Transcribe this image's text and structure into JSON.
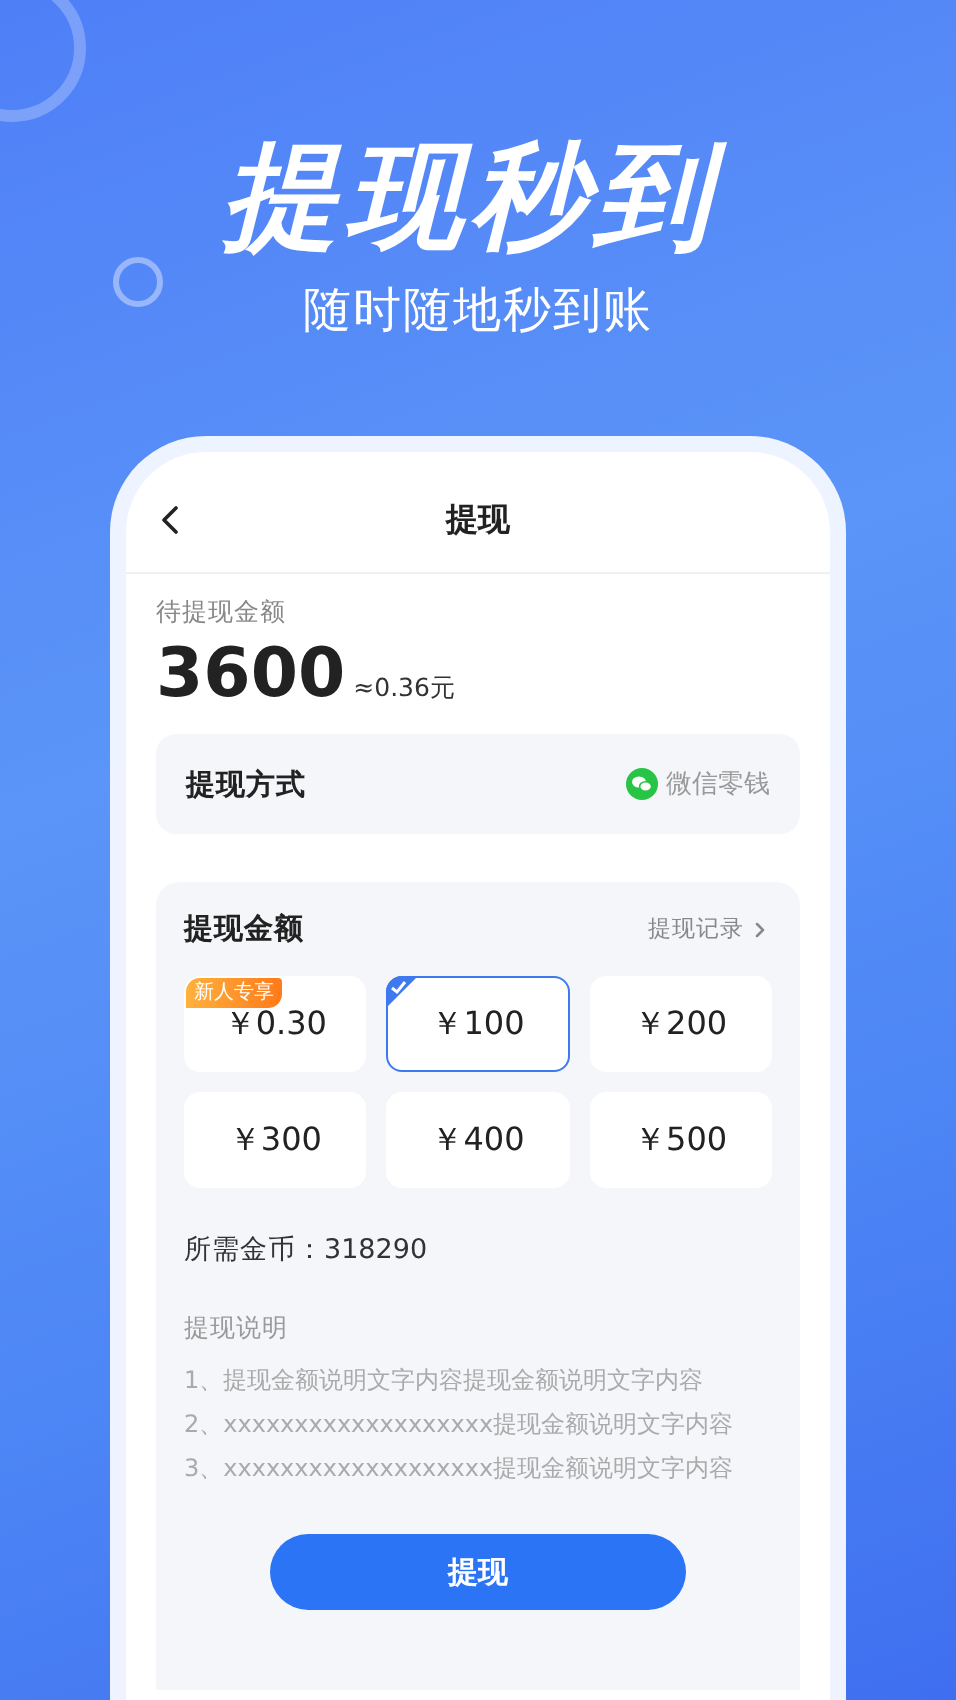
{
  "headline": "提现秒到",
  "subheadline": "随时随地秒到账",
  "screen": {
    "nav_title": "提现",
    "pending": {
      "label": "待提现金额",
      "amount": "3600",
      "approx": "≈0.36元"
    },
    "method": {
      "label": "提现方式",
      "value": "微信零钱"
    },
    "amount_section": {
      "title": "提现金额",
      "record_link": "提现记录",
      "options": [
        {
          "value": "￥0.30",
          "badge": "新人专享",
          "selected": false
        },
        {
          "value": "￥100",
          "selected": true
        },
        {
          "value": "￥200",
          "selected": false
        },
        {
          "value": "￥300",
          "selected": false
        },
        {
          "value": "￥400",
          "selected": false
        },
        {
          "value": "￥500",
          "selected": false
        }
      ],
      "required_label": "所需金币：",
      "required_value": "318290",
      "notes_title": "提现说明",
      "notes": [
        "1、提现金额说明文字内容提现金额说明文字内容",
        "2、xxxxxxxxxxxxxxxxxxx提现金额说明文字内容",
        "3、xxxxxxxxxxxxxxxxxxx提现金额说明文字内容"
      ],
      "submit": "提现"
    }
  }
}
